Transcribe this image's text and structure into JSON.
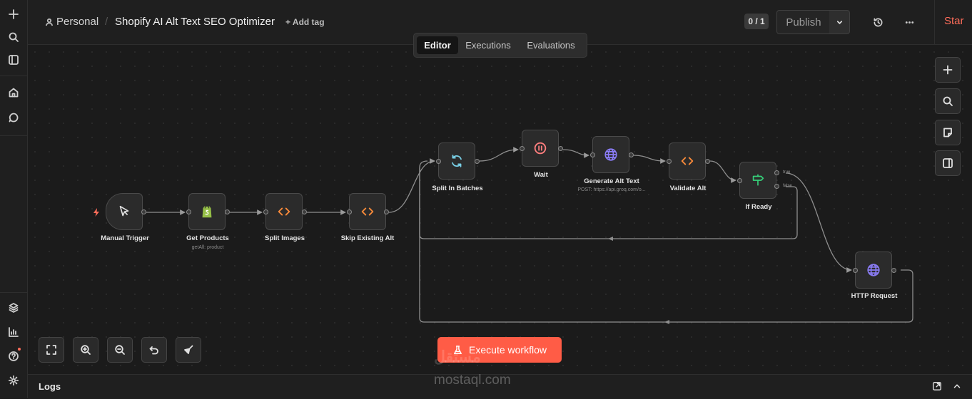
{
  "header": {
    "project": "Personal",
    "separator": "/",
    "workflow_name": "Shopify AI Alt Text SEO Optimizer",
    "add_tag": "+ Add tag",
    "counter": "0 / 1",
    "publish": "Publish",
    "star": "Star"
  },
  "tabs": [
    {
      "label": "Editor",
      "active": true
    },
    {
      "label": "Executions",
      "active": false
    },
    {
      "label": "Evaluations",
      "active": false
    }
  ],
  "nodes": [
    {
      "name": "Manual Trigger",
      "subtitle": "",
      "icon": "cursor-icon"
    },
    {
      "name": "Get Products",
      "subtitle": "getAll: product",
      "icon": "shopify-icon"
    },
    {
      "name": "Split Images",
      "subtitle": "",
      "icon": "code-icon"
    },
    {
      "name": "Skip Existing Alt",
      "subtitle": "",
      "icon": "code-icon"
    },
    {
      "name": "Split In Batches",
      "subtitle": "",
      "icon": "loop-icon"
    },
    {
      "name": "Wait",
      "subtitle": "",
      "icon": "pause-icon"
    },
    {
      "name": "Generate Alt Text",
      "subtitle": "POST: https://api.groq.com/o...",
      "icon": "globe-icon"
    },
    {
      "name": "Validate Alt",
      "subtitle": "",
      "icon": "code-icon"
    },
    {
      "name": "If Ready",
      "subtitle": "",
      "icon": "signpost-icon"
    },
    {
      "name": "HTTP Request",
      "subtitle": "",
      "icon": "globe-icon"
    }
  ],
  "branches": {
    "true_label": "true",
    "false_label": "false"
  },
  "execute_button": "Execute workflow",
  "logs": {
    "title": "Logs"
  },
  "watermark": {
    "arabic": "مستقل",
    "latin": "mostaql.com"
  },
  "colors": {
    "accent": "#ff6d5a",
    "execute": "#ff5c46",
    "code_icon": "#ff8c3a",
    "globe_icon": "#8a7cf5",
    "loop_icon": "#7ad1e8",
    "shopify": "#95bf47",
    "pause": "#ff7e7e",
    "signpost": "#36d17a"
  }
}
